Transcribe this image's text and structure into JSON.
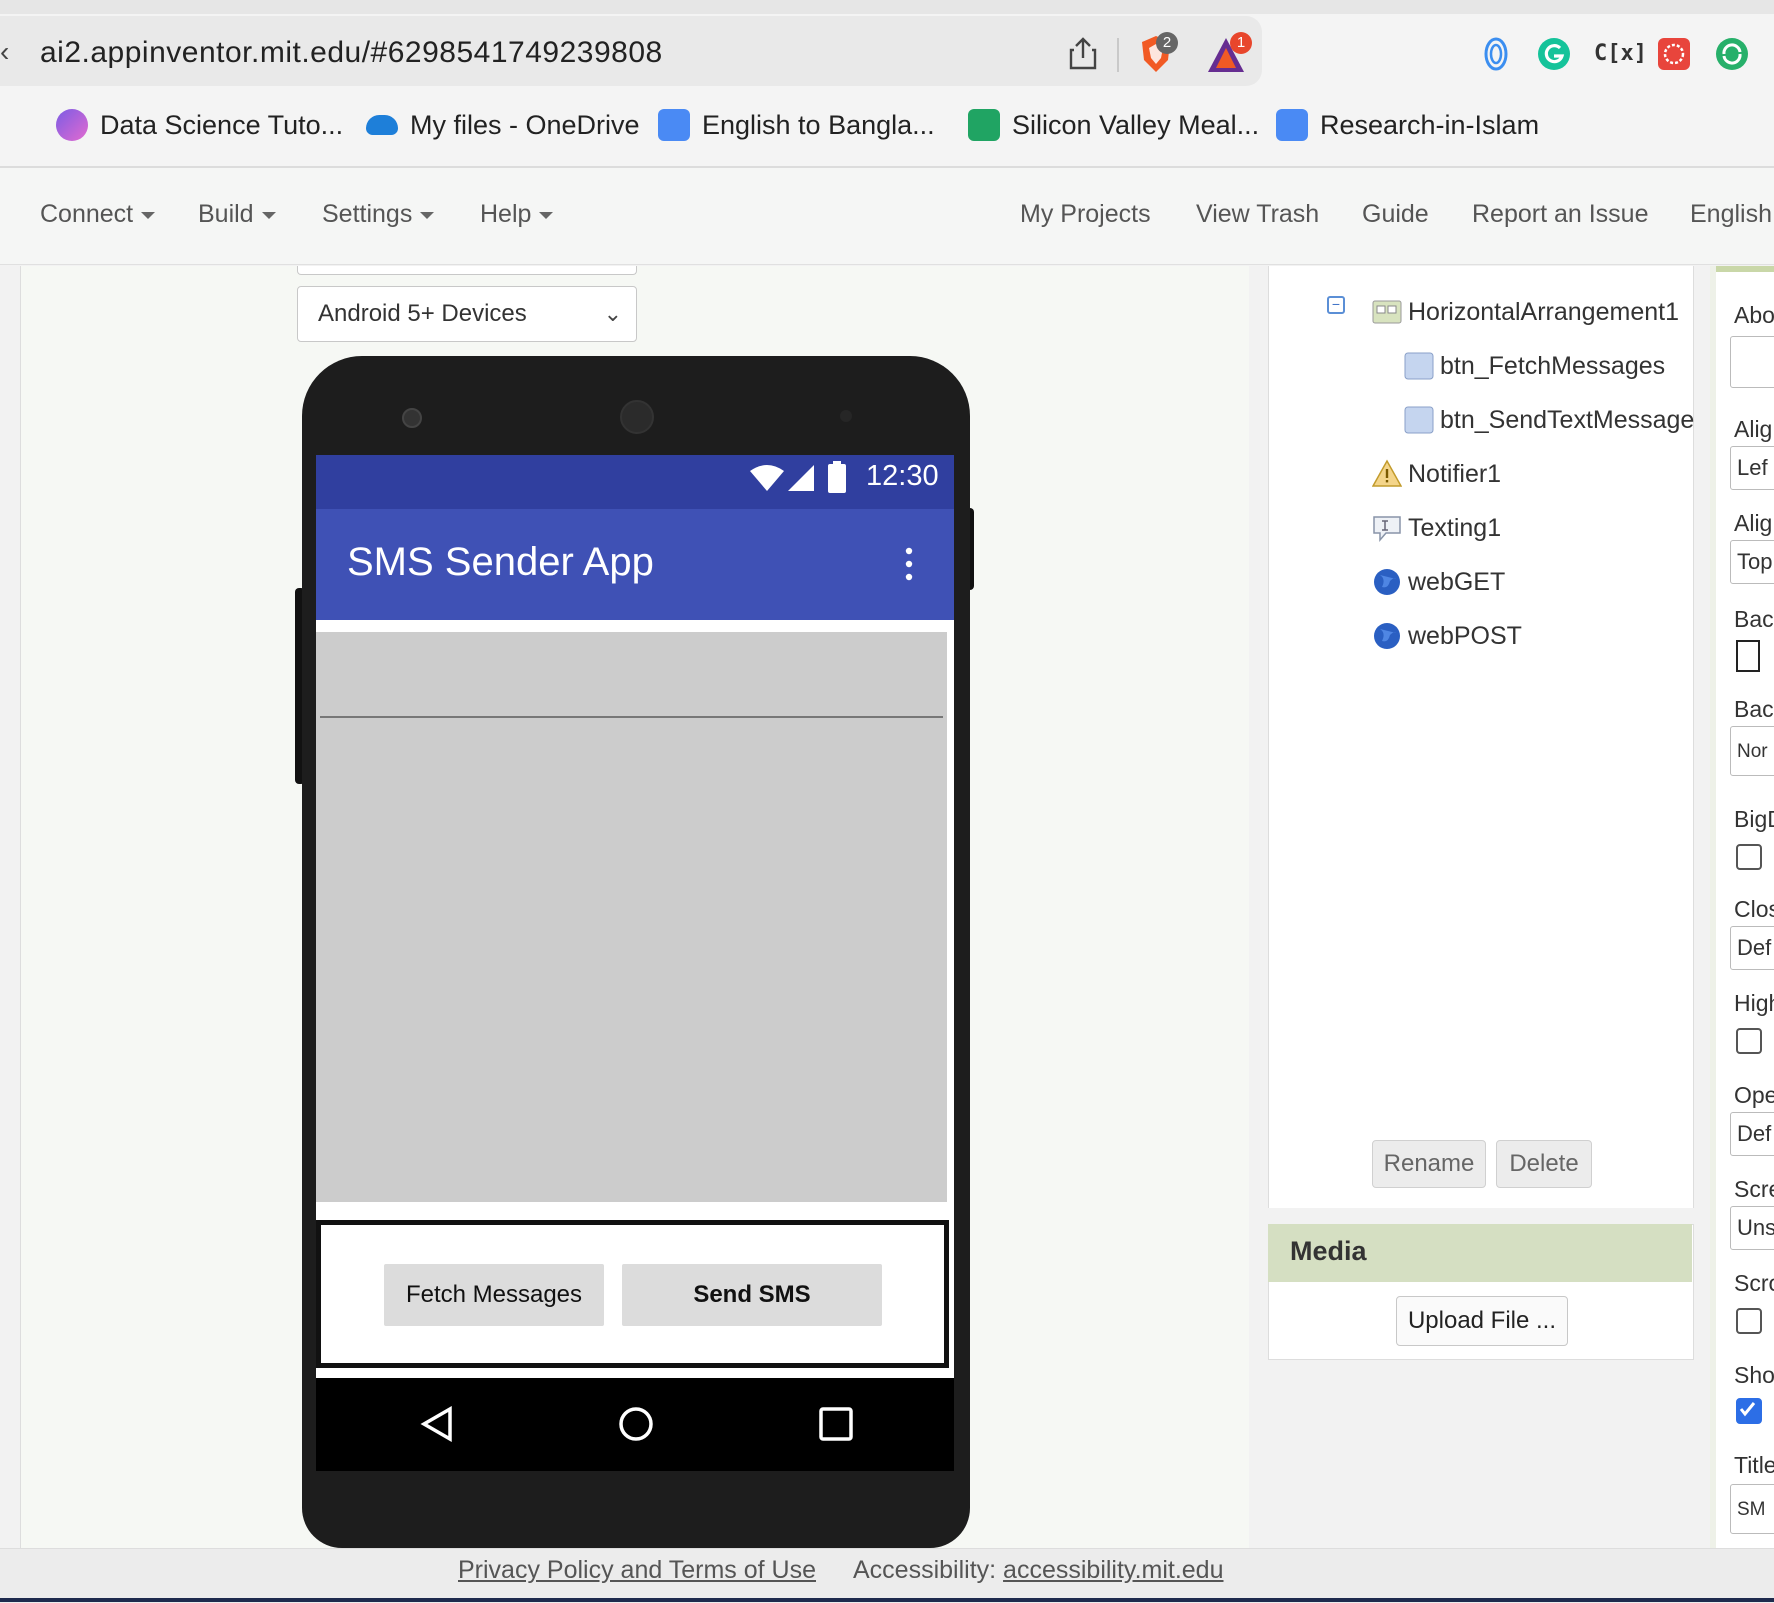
{
  "browser": {
    "url": "ai2.appinventor.mit.edu/#6298541749239808",
    "back_glyph": "‹",
    "brave_shield_count": "2",
    "brave_rewards_count": "1",
    "extension_text": "C[x]",
    "bookmarks": [
      {
        "label": "Data Science Tuto...",
        "icon": "gradient-logo-icon",
        "color": "#8a6fe0"
      },
      {
        "label": "My files - OneDrive",
        "icon": "onedrive-cloud-icon",
        "color": "#1e7fd9"
      },
      {
        "label": "English to Bangla...",
        "icon": "google-translate-icon",
        "color": "#4a8af4"
      },
      {
        "label": "Silicon Valley Meal...",
        "icon": "google-sheets-icon",
        "color": "#20a463"
      },
      {
        "label": "Research-in-Islam",
        "icon": "google-docs-icon",
        "color": "#4a8af4"
      }
    ]
  },
  "menu": {
    "left": [
      "Connect",
      "Build",
      "Settings",
      "Help"
    ],
    "right": [
      "My Projects",
      "View Trash",
      "Guide",
      "Report an Issue",
      "English"
    ]
  },
  "viewer": {
    "device_select": "Android 5+ Devices",
    "phone": {
      "time": "12:30",
      "app_title": "SMS Sender App",
      "buttons": {
        "fetch": "Fetch Messages",
        "send": "Send SMS"
      }
    }
  },
  "components": {
    "tree": [
      {
        "label": "HorizontalArrangement1",
        "icon": "arrangement-icon",
        "level": 1
      },
      {
        "label": "btn_FetchMessages",
        "icon": "button-icon",
        "level": 2
      },
      {
        "label": "btn_SendTextMessage",
        "icon": "button-icon",
        "level": 2
      },
      {
        "label": "Notifier1",
        "icon": "warning-icon",
        "level": 1
      },
      {
        "label": "Texting1",
        "icon": "texting-icon",
        "level": 1
      },
      {
        "label": "webGET",
        "icon": "globe-icon",
        "level": 1
      },
      {
        "label": "webPOST",
        "icon": "globe-icon",
        "level": 1
      }
    ],
    "rename_label": "Rename",
    "delete_label": "Delete"
  },
  "media": {
    "title": "Media",
    "upload_label": "Upload File ..."
  },
  "properties": {
    "items": [
      {
        "label": "Abo",
        "type": "field",
        "value": ""
      },
      {
        "label": "Alig",
        "type": "field",
        "value": "Lef"
      },
      {
        "label": "Alig",
        "type": "field",
        "value": "Top"
      },
      {
        "label": "Bac",
        "type": "swatch"
      },
      {
        "label": "Bac",
        "type": "field",
        "value": "Nor"
      },
      {
        "label": "BigD",
        "type": "check",
        "checked": false
      },
      {
        "label": "Clos",
        "type": "field",
        "value": "Def"
      },
      {
        "label": "High",
        "type": "check",
        "checked": false
      },
      {
        "label": "Ope",
        "type": "field",
        "value": "Def"
      },
      {
        "label": "Scre",
        "type": "field",
        "value": "Uns"
      },
      {
        "label": "Scro",
        "type": "check",
        "checked": false
      },
      {
        "label": "Sho",
        "type": "check",
        "checked": true
      },
      {
        "label": "Title",
        "type": "field",
        "value": "SM"
      }
    ]
  },
  "footer": {
    "privacy": "Privacy Policy and Terms of Use",
    "accessibility_prefix": "Accessibility: ",
    "accessibility_link": "accessibility.mit.edu"
  }
}
